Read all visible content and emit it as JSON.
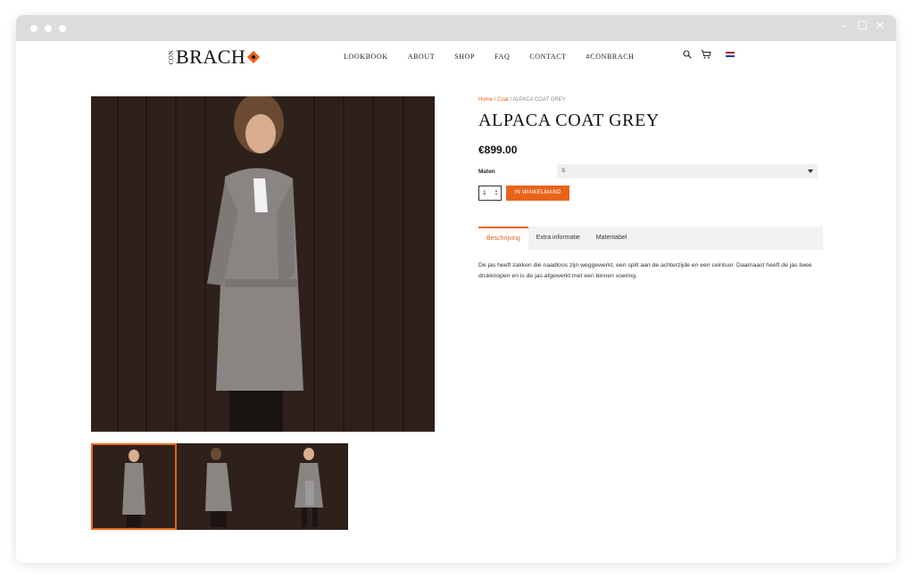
{
  "nav": {
    "logo_small": "CON",
    "logo_main": "BRACH",
    "menu": [
      "LOOKBOOK",
      "ABOUT",
      "SHOP",
      "FAQ",
      "CONTACT",
      "#CONBRACH"
    ]
  },
  "product": {
    "breadcrumb": {
      "home": "Home",
      "sep1": " / ",
      "category": "Coat",
      "sep2": " / ",
      "current": "ALPACA COAT GREY"
    },
    "title": "ALPACA COAT GREY",
    "price": "€899.00",
    "size_label": "Maten",
    "size_value": "S",
    "quantity": "1",
    "add_to_cart": "IN WINKELMAND",
    "tabs": [
      "Beschrijving",
      "Extra informatie",
      "Matentabel"
    ],
    "description": "De jas heeft zakken die naadloos zijn weggewerkt, een split aan de achterzijde en een ceintuur. Daarnaast heeft de jas twee drukknopen en is de jas afgewerkt met een binnen voering."
  },
  "colors": {
    "accent": "#e8641b",
    "background_wood": "#2e211b",
    "coat": "#8a8583"
  }
}
